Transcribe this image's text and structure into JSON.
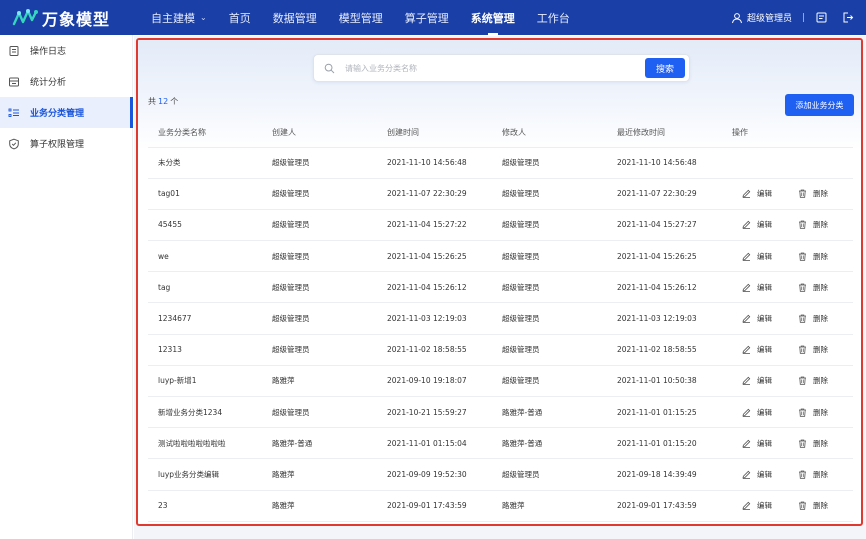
{
  "app": {
    "logo_text": "万象模型"
  },
  "nav": [
    {
      "label": "自主建模",
      "caret": true,
      "active": false
    },
    {
      "label": "首页",
      "caret": false,
      "active": false
    },
    {
      "label": "数据管理",
      "caret": false,
      "active": false
    },
    {
      "label": "模型管理",
      "caret": false,
      "active": false
    },
    {
      "label": "算子管理",
      "caret": false,
      "active": false
    },
    {
      "label": "系统管理",
      "caret": false,
      "active": true
    },
    {
      "label": "工作台",
      "caret": false,
      "active": false
    }
  ],
  "user": {
    "name": "超级管理员"
  },
  "sidebar": {
    "items": [
      {
        "label": "操作日志",
        "icon": "log-icon",
        "active": false
      },
      {
        "label": "统计分析",
        "icon": "stats-icon",
        "active": false
      },
      {
        "label": "业务分类管理",
        "icon": "list-icon",
        "active": true
      },
      {
        "label": "算子权限管理",
        "icon": "shield-icon",
        "active": false
      }
    ]
  },
  "search": {
    "placeholder": "请输入业务分类名称",
    "button": "搜索"
  },
  "summary": {
    "prefix": "共",
    "count": "12",
    "suffix": "个"
  },
  "add_button": "添加业务分类",
  "table": {
    "columns": [
      "业务分类名称",
      "创建人",
      "创建时间",
      "修改人",
      "最近修改时间",
      "操作"
    ],
    "actions": {
      "edit": "编辑",
      "delete": "删除"
    },
    "rows": [
      {
        "name": "未分类",
        "creator": "超级管理员",
        "created": "2021-11-10 14:56:48",
        "modifier": "超级管理员",
        "modified": "2021-11-10 14:56:48",
        "ops": false
      },
      {
        "name": "tag01",
        "creator": "超级管理员",
        "created": "2021-11-07 22:30:29",
        "modifier": "超级管理员",
        "modified": "2021-11-07 22:30:29",
        "ops": true
      },
      {
        "name": "45455",
        "creator": "超级管理员",
        "created": "2021-11-04 15:27:22",
        "modifier": "超级管理员",
        "modified": "2021-11-04 15:27:27",
        "ops": true
      },
      {
        "name": "we",
        "creator": "超级管理员",
        "created": "2021-11-04 15:26:25",
        "modifier": "超级管理员",
        "modified": "2021-11-04 15:26:25",
        "ops": true
      },
      {
        "name": "tag",
        "creator": "超级管理员",
        "created": "2021-11-04 15:26:12",
        "modifier": "超级管理员",
        "modified": "2021-11-04 15:26:12",
        "ops": true
      },
      {
        "name": "1234677",
        "creator": "超级管理员",
        "created": "2021-11-03 12:19:03",
        "modifier": "超级管理员",
        "modified": "2021-11-03 12:19:03",
        "ops": true
      },
      {
        "name": "12313",
        "creator": "超级管理员",
        "created": "2021-11-02 18:58:55",
        "modifier": "超级管理员",
        "modified": "2021-11-02 18:58:55",
        "ops": true
      },
      {
        "name": "luyp-新增1",
        "creator": "路雅萍",
        "created": "2021-09-10 19:18:07",
        "modifier": "超级管理员",
        "modified": "2021-11-01 10:50:38",
        "ops": true
      },
      {
        "name": "新增业务分类1234",
        "creator": "超级管理员",
        "created": "2021-10-21 15:59:27",
        "modifier": "路雅萍-普通",
        "modified": "2021-11-01 01:15:25",
        "ops": true
      },
      {
        "name": "测试啦啦啦啦啦啦啦",
        "creator": "路雅萍-普通",
        "created": "2021-11-01 01:15:04",
        "modifier": "路雅萍-普通",
        "modified": "2021-11-01 01:15:20",
        "ops": true
      },
      {
        "name": "luyp业务分类编辑",
        "creator": "路雅萍",
        "created": "2021-09-09 19:52:30",
        "modifier": "超级管理员",
        "modified": "2021-09-18 14:39:49",
        "ops": true
      },
      {
        "name": "23",
        "creator": "路雅萍",
        "created": "2021-09-01 17:43:59",
        "modifier": "路雅萍",
        "modified": "2021-09-01 17:43:59",
        "ops": true
      }
    ]
  }
}
